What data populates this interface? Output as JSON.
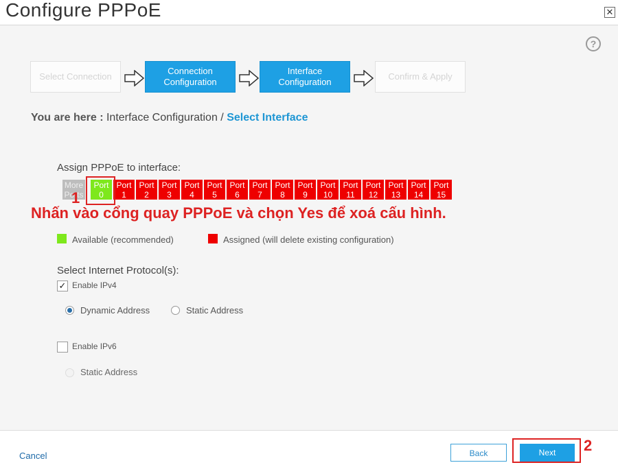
{
  "window": {
    "title": "Configure PPPoE",
    "close_glyph": "✕"
  },
  "help_glyph": "?",
  "wizard": {
    "steps": [
      {
        "label": "Select Connection",
        "state": "inactive"
      },
      {
        "label": "Connection Configuration",
        "state": "active"
      },
      {
        "label": "Interface Configuration",
        "state": "active"
      },
      {
        "label": "Confirm & Apply",
        "state": "inactive"
      }
    ]
  },
  "breadcrumb": {
    "label": "You are here :",
    "path": "Interface Configuration /",
    "current": "Select Interface"
  },
  "assign": {
    "label": "Assign PPPoE to interface:",
    "more_ports": "More Ports",
    "ports": [
      {
        "top": "Port",
        "num": "0",
        "status": "available"
      },
      {
        "top": "Port",
        "num": "1",
        "status": "assigned"
      },
      {
        "top": "Port",
        "num": "2",
        "status": "assigned"
      },
      {
        "top": "Port",
        "num": "3",
        "status": "assigned"
      },
      {
        "top": "Port",
        "num": "4",
        "status": "assigned"
      },
      {
        "top": "Port",
        "num": "5",
        "status": "assigned"
      },
      {
        "top": "Port",
        "num": "6",
        "status": "assigned"
      },
      {
        "top": "Port",
        "num": "7",
        "status": "assigned"
      },
      {
        "top": "Port",
        "num": "8",
        "status": "assigned"
      },
      {
        "top": "Port",
        "num": "9",
        "status": "assigned"
      },
      {
        "top": "Port",
        "num": "10",
        "status": "assigned"
      },
      {
        "top": "Port",
        "num": "11",
        "status": "assigned"
      },
      {
        "top": "Port",
        "num": "12",
        "status": "assigned"
      },
      {
        "top": "Port",
        "num": "13",
        "status": "assigned"
      },
      {
        "top": "Port",
        "num": "14",
        "status": "assigned"
      },
      {
        "top": "Port",
        "num": "15",
        "status": "assigned"
      }
    ]
  },
  "annotation": {
    "marker_1": "1",
    "marker_2": "2",
    "instruction": "Nhấn vào cổng quay PPPoE và chọn Yes để xoá cấu hình."
  },
  "legend": {
    "available": "Available (recommended)",
    "assigned": "Assigned (will delete existing configuration)"
  },
  "protocol": {
    "label": "Select Internet Protocol(s):",
    "ipv4": {
      "label": "Enable IPv4",
      "checked": true
    },
    "ipv4_options": {
      "dynamic": "Dynamic Address",
      "static": "Static Address",
      "selected": "dynamic"
    },
    "ipv6": {
      "label": "Enable IPv6",
      "checked": false
    },
    "ipv6_options": {
      "static": "Static Address"
    }
  },
  "footer": {
    "cancel": "Cancel",
    "back": "Back",
    "next": "Next"
  },
  "colors": {
    "accent": "#1ea0e4",
    "assigned": "#ee0000",
    "available": "#7ee81c",
    "annotation": "#dd2222"
  }
}
